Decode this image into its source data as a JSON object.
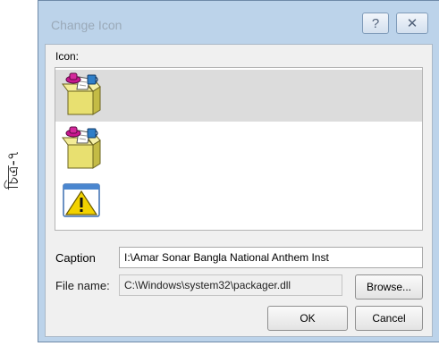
{
  "side_caption": "চিত্র-৭",
  "dialog": {
    "title": "Change Icon",
    "help_label": "?",
    "close_label": "✕"
  },
  "icon_list": {
    "label": "Icon:",
    "items": [
      {
        "icon": "package-box-icon",
        "selected": true
      },
      {
        "icon": "package-box-icon",
        "selected": false
      },
      {
        "icon": "warning-icon",
        "selected": false
      }
    ]
  },
  "caption": {
    "label": "Caption",
    "value": "I:\\Amar Sonar Bangla National Anthem Inst"
  },
  "file_name": {
    "label": "File name:",
    "value": "C:\\Windows\\system32\\packager.dll"
  },
  "buttons": {
    "browse": "Browse...",
    "ok": "OK",
    "cancel": "Cancel"
  },
  "colors": {
    "frame": "#bcd3ea",
    "client": "#f0f0f0",
    "selection": "#dcdcdc",
    "box_yellow": "#e8e070",
    "box_magenta": "#c8158f",
    "warning_yellow": "#f2d200"
  }
}
